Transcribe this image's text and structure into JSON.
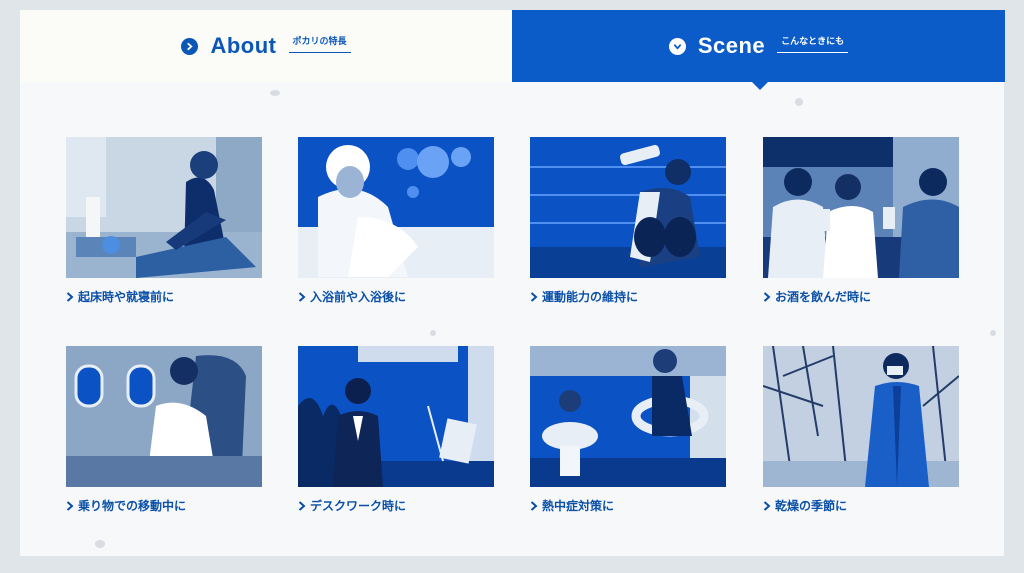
{
  "tabs": [
    {
      "label": "About",
      "sub": "ポカリの特長",
      "icon": "chevron-right-circle-icon",
      "active": false
    },
    {
      "label": "Scene",
      "sub": "こんなときにも",
      "icon": "chevron-down-circle-icon",
      "active": true
    }
  ],
  "scenes": [
    {
      "caption": "起床時や就寝前に",
      "image": "man-waking-alarm-clock"
    },
    {
      "caption": "入浴前や入浴後に",
      "image": "woman-towel-bath"
    },
    {
      "caption": "運動能力の維持に",
      "image": "boxer-drinking"
    },
    {
      "caption": "お酒を飲んだ時に",
      "image": "friends-toasting-bar"
    },
    {
      "caption": "乗り物での移動中に",
      "image": "woman-airplane-seat"
    },
    {
      "caption": "デスクワーク時に",
      "image": "woman-desk-laptop"
    },
    {
      "caption": "熱中症対策に",
      "image": "kids-swim-rings"
    },
    {
      "caption": "乾燥の季節に",
      "image": "woman-mask-winter-trees"
    }
  ],
  "colors": {
    "brand": "#0b5cc9",
    "text": "#0b50a8",
    "panel": "#f7f8fa"
  }
}
